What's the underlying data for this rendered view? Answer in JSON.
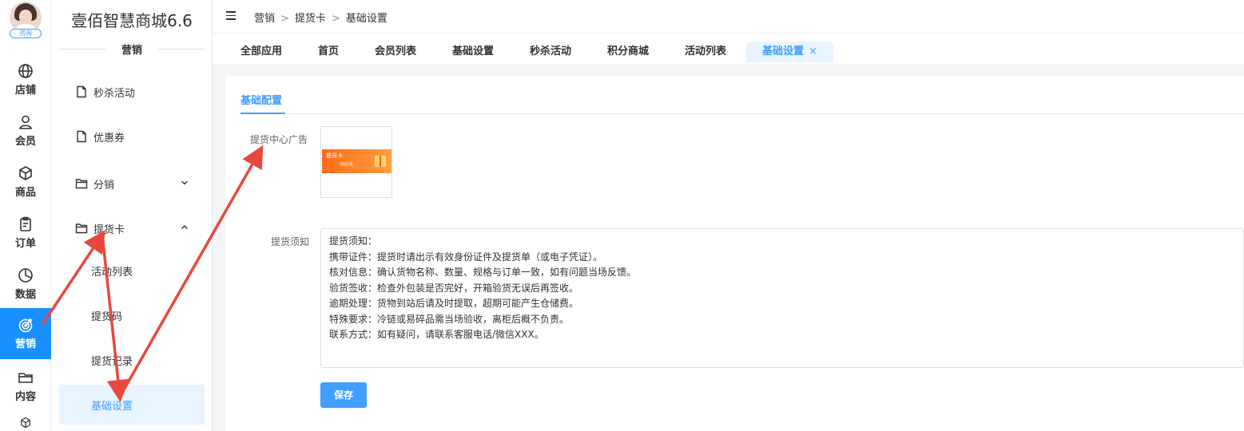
{
  "app": {
    "brand": "壹佰智慧商城6.6",
    "role_badge": "咨询"
  },
  "rail": {
    "items": [
      {
        "label": "店铺",
        "icon": "globe-icon"
      },
      {
        "label": "会员",
        "icon": "user-icon"
      },
      {
        "label": "商品",
        "icon": "box-icon"
      },
      {
        "label": "订单",
        "icon": "clipboard-icon"
      },
      {
        "label": "数据",
        "icon": "pie-chart-icon"
      },
      {
        "label": "营销",
        "icon": "target-icon",
        "active": true
      },
      {
        "label": "内容",
        "icon": "folder-icon"
      }
    ]
  },
  "sidebar": {
    "section_title": "营销",
    "items": [
      {
        "label": "秒杀活动",
        "icon": "file-icon"
      },
      {
        "label": "优惠券",
        "icon": "file-icon"
      },
      {
        "label": "分销",
        "icon": "folder-icon",
        "expanded": false
      },
      {
        "label": "提货卡",
        "icon": "folder-icon",
        "expanded": true
      }
    ],
    "sub_items": [
      {
        "label": "活动列表"
      },
      {
        "label": "提货码"
      },
      {
        "label": "提货记录"
      },
      {
        "label": "基础设置",
        "active": true
      }
    ]
  },
  "breadcrumb": [
    "营销",
    "提货卡",
    "基础设置"
  ],
  "breadcrumb_sep": ">",
  "tabs": [
    {
      "label": "全部应用"
    },
    {
      "label": "首页"
    },
    {
      "label": "会员列表"
    },
    {
      "label": "基础设置"
    },
    {
      "label": "秒杀活动"
    },
    {
      "label": "积分商城"
    },
    {
      "label": "活动列表"
    },
    {
      "label": "基础设置",
      "active": true,
      "close": "×"
    }
  ],
  "panel": {
    "tab": "基础配置",
    "ad_label": "提货中心广告",
    "ad_banner": {
      "line1": "提货卡",
      "line2": "领好礼"
    },
    "notice_label": "提货须知",
    "notice_text": "提货须知：\n携带证件：提货时请出示有效身份证件及提货单（或电子凭证）。\n核对信息：确认货物名称、数量、规格与订单一致，如有问题当场反馈。\n验货签收：检查外包装是否完好，开箱验货无误后再签收。\n逾期处理：货物到站后请及时提取，超期可能产生仓储费。\n特殊要求：冷链或易碎品需当场验收，离柜后概不负责。\n联系方式：如有疑问，请联系客服电话/微信XXX。",
    "save_label": "保存"
  },
  "colors": {
    "accent": "#409eff",
    "rail_active": "#1890ff",
    "annotation_arrow": "#e8473f"
  }
}
